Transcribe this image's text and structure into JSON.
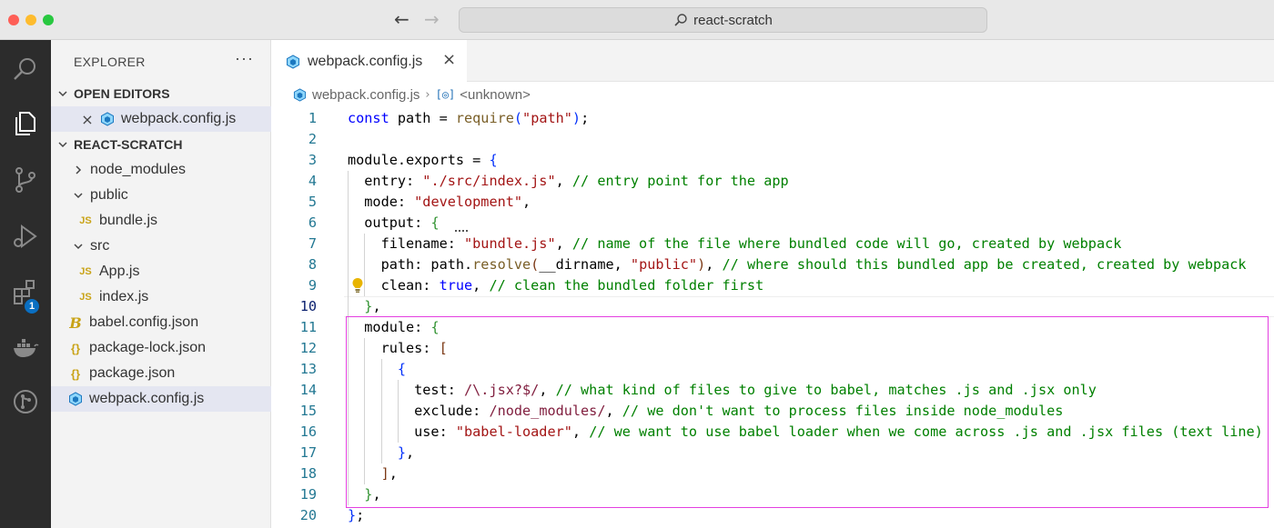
{
  "window": {
    "title": "react-scratch"
  },
  "sidebar": {
    "header": "EXPLORER",
    "more_label": "···",
    "open_editors": {
      "label": "OPEN EDITORS",
      "items": [
        {
          "name": "webpack.config.js"
        }
      ]
    },
    "project": {
      "label": "REACT-SCRATCH",
      "tree": [
        {
          "name": "node_modules",
          "type": "folder",
          "expanded": false
        },
        {
          "name": "public",
          "type": "folder",
          "expanded": true
        },
        {
          "name": "bundle.js",
          "type": "js"
        },
        {
          "name": "src",
          "type": "folder",
          "expanded": true
        },
        {
          "name": "App.js",
          "type": "js"
        },
        {
          "name": "index.js",
          "type": "js"
        },
        {
          "name": "babel.config.json",
          "type": "babel"
        },
        {
          "name": "package-lock.json",
          "type": "json"
        },
        {
          "name": "package.json",
          "type": "json"
        },
        {
          "name": "webpack.config.js",
          "type": "webpack",
          "selected": true
        }
      ]
    }
  },
  "activitybar": {
    "extensions_badge": "1"
  },
  "editor": {
    "tab": {
      "label": "webpack.config.js"
    },
    "breadcrumb": {
      "file": "webpack.config.js",
      "symbol_icon": "[◎]",
      "symbol": "<unknown>"
    },
    "current_line": 10,
    "highlight": {
      "from_line": 11,
      "to_line": 19,
      "color": "#e43fe0"
    },
    "lines": [
      {
        "n": "1",
        "tokens": [
          [
            "kw",
            "const"
          ],
          [
            "t",
            " path = "
          ],
          [
            "fn",
            "require"
          ],
          [
            "bk1",
            "("
          ],
          [
            "str",
            "\"path\""
          ],
          [
            "bk1",
            ")"
          ],
          [
            "t",
            ";"
          ]
        ]
      },
      {
        "n": "2",
        "tokens": []
      },
      {
        "n": "3",
        "tokens": [
          [
            "t",
            "module.exports = "
          ],
          [
            "bk1",
            "{"
          ]
        ]
      },
      {
        "n": "4",
        "tokens": [
          [
            "t",
            "  entry: "
          ],
          [
            "str",
            "\"./src/index.js\""
          ],
          [
            "t",
            ", "
          ],
          [
            "cmt",
            "// entry point for the app"
          ]
        ]
      },
      {
        "n": "5",
        "tokens": [
          [
            "t",
            "  mode: "
          ],
          [
            "str",
            "\"development\""
          ],
          [
            "t",
            ","
          ]
        ]
      },
      {
        "n": "6",
        "tokens": [
          [
            "t",
            "  output: "
          ],
          [
            "bk2",
            "{"
          ]
        ]
      },
      {
        "n": "7",
        "tokens": [
          [
            "t",
            "    filename: "
          ],
          [
            "str",
            "\"bundle.js\""
          ],
          [
            "t",
            ", "
          ],
          [
            "cmt",
            "// name of the file where bundled code will go, created by webpack"
          ]
        ]
      },
      {
        "n": "8",
        "tokens": [
          [
            "t",
            "    path: path."
          ],
          [
            "fn",
            "resolve"
          ],
          [
            "bk3",
            "("
          ],
          [
            "t",
            "__dirname, "
          ],
          [
            "str",
            "\"public\""
          ],
          [
            "bk3",
            ")"
          ],
          [
            "t",
            ", "
          ],
          [
            "cmt",
            "// where should this bundled app be created, created by webpack"
          ]
        ]
      },
      {
        "n": "9",
        "tokens": [
          [
            "t",
            "    clean: "
          ],
          [
            "kw",
            "true"
          ],
          [
            "t",
            ", "
          ],
          [
            "cmt",
            "// clean the bundled folder first"
          ]
        ]
      },
      {
        "n": "10",
        "tokens": [
          [
            "t",
            "  "
          ],
          [
            "bk2",
            "}"
          ],
          [
            "t",
            ","
          ]
        ]
      },
      {
        "n": "11",
        "tokens": [
          [
            "t",
            "  module: "
          ],
          [
            "bk2",
            "{"
          ]
        ]
      },
      {
        "n": "12",
        "tokens": [
          [
            "t",
            "    rules: "
          ],
          [
            "bk3",
            "["
          ]
        ]
      },
      {
        "n": "13",
        "tokens": [
          [
            "t",
            "      "
          ],
          [
            "bk1",
            "{"
          ]
        ]
      },
      {
        "n": "14",
        "tokens": [
          [
            "t",
            "        test: "
          ],
          [
            "rgx",
            "/\\.jsx?$/"
          ],
          [
            "t",
            ", "
          ],
          [
            "cmt",
            "// what kind of files to give to babel, matches .js and .jsx only"
          ]
        ]
      },
      {
        "n": "15",
        "tokens": [
          [
            "t",
            "        exclude: "
          ],
          [
            "rgx",
            "/node_modules/"
          ],
          [
            "t",
            ", "
          ],
          [
            "cmt",
            "// we don't want to process files inside node_modules"
          ]
        ]
      },
      {
        "n": "16",
        "tokens": [
          [
            "t",
            "        use: "
          ],
          [
            "str",
            "\"babel-loader\""
          ],
          [
            "t",
            ", "
          ],
          [
            "cmt",
            "// we want to use babel loader when we come across .js and .jsx files (text line)"
          ]
        ]
      },
      {
        "n": "17",
        "tokens": [
          [
            "t",
            "      "
          ],
          [
            "bk1",
            "}"
          ],
          [
            "t",
            ","
          ]
        ]
      },
      {
        "n": "18",
        "tokens": [
          [
            "t",
            "    "
          ],
          [
            "bk3",
            "]"
          ],
          [
            "t",
            ","
          ]
        ]
      },
      {
        "n": "19",
        "tokens": [
          [
            "t",
            "  "
          ],
          [
            "bk2",
            "}"
          ],
          [
            "t",
            ","
          ]
        ]
      },
      {
        "n": "20",
        "tokens": [
          [
            "bk1",
            "}"
          ],
          [
            "t",
            ";"
          ]
        ]
      }
    ]
  },
  "colors": {
    "activitybar": "#2c2c2c",
    "sidebar": "#f3f3f3",
    "selection": "#e4e6f1",
    "keyword": "#0000ff",
    "string": "#a31515",
    "comment": "#008000",
    "highlight_box": "#e43fe0"
  }
}
